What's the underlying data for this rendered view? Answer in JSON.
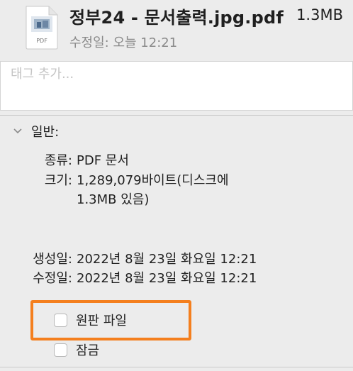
{
  "header": {
    "file_name": "정부24 - 문서출력.jpg.pdf",
    "file_size": "1.3MB",
    "modified": "수정일: 오늘 12:21",
    "icon": "pdf-document-icon",
    "icon_label": "PDF"
  },
  "tags": {
    "placeholder": "태그 추가..."
  },
  "general": {
    "title": "일반:",
    "kind_label": "종류:",
    "kind_value": "PDF 문서",
    "size_label": "크기:",
    "size_value_line1": "1,289,079바이트(디스크에",
    "size_value_line2": "1.3MB 있음)",
    "created_label": "생성일:",
    "created_value": "2022년 8월 23일 화요일 12:21",
    "modified_label": "수정일:",
    "modified_value": "2022년 8월 23일 화요일 12:21",
    "stationery_label": "원판 파일",
    "locked_label": "잠금"
  },
  "colors": {
    "highlight": "#f47f1e",
    "background": "#ececec"
  }
}
